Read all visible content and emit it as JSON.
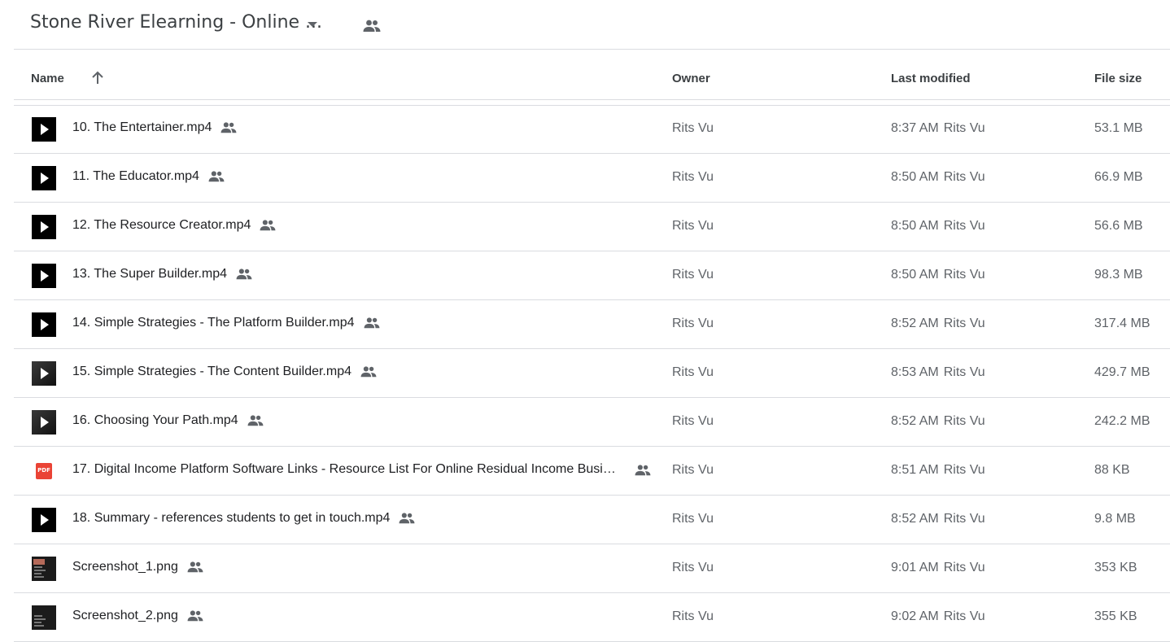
{
  "header": {
    "folder_title": "Stone River Elearning - Online ...",
    "title_dropdown_icon": "caret-down-icon",
    "title_shared_icon": "people-icon"
  },
  "columns": {
    "name": "Name",
    "owner": "Owner",
    "last_modified": "Last modified",
    "file_size": "File size",
    "sort_icon": "arrow-up-icon"
  },
  "colors": {
    "text": "#3c4043",
    "muted": "#5f6368",
    "divider": "#dadce0",
    "pdf": "#ea4335"
  },
  "files": [
    {
      "type": "video",
      "name": "10. The Entertainer.mp4",
      "owner": "Rits Vu",
      "time": "8:37 AM",
      "modified_by": "Rits Vu",
      "size": "53.1 MB",
      "shared": true
    },
    {
      "type": "video",
      "name": "11. The Educator.mp4",
      "owner": "Rits Vu",
      "time": "8:50 AM",
      "modified_by": "Rits Vu",
      "size": "66.9 MB",
      "shared": true
    },
    {
      "type": "video",
      "name": "12. The Resource Creator.mp4",
      "owner": "Rits Vu",
      "time": "8:50 AM",
      "modified_by": "Rits Vu",
      "size": "56.6 MB",
      "shared": true
    },
    {
      "type": "video",
      "name": "13. The Super Builder.mp4",
      "owner": "Rits Vu",
      "time": "8:50 AM",
      "modified_by": "Rits Vu",
      "size": "98.3 MB",
      "shared": true
    },
    {
      "type": "video",
      "name": "14. Simple Strategies - The Platform Builder.mp4",
      "owner": "Rits Vu",
      "time": "8:52 AM",
      "modified_by": "Rits Vu",
      "size": "317.4 MB",
      "shared": true
    },
    {
      "type": "video-dark",
      "name": "15. Simple Strategies - The Content Builder.mp4",
      "owner": "Rits Vu",
      "time": "8:53 AM",
      "modified_by": "Rits Vu",
      "size": "429.7 MB",
      "shared": true
    },
    {
      "type": "video-dark",
      "name": "16. Choosing Your Path.mp4",
      "owner": "Rits Vu",
      "time": "8:52 AM",
      "modified_by": "Rits Vu",
      "size": "242.2 MB",
      "shared": true
    },
    {
      "type": "pdf",
      "pdf_label": "PDF",
      "name": "17. Digital Income Platform Software Links - Resource List For Online Residual Income Busi…",
      "owner": "Rits Vu",
      "time": "8:51 AM",
      "modified_by": "Rits Vu",
      "size": "88 KB",
      "shared": true
    },
    {
      "type": "video",
      "name": "18. Summary - references students to get in touch.mp4",
      "owner": "Rits Vu",
      "time": "8:52 AM",
      "modified_by": "Rits Vu",
      "size": "9.8 MB",
      "shared": true
    },
    {
      "type": "image",
      "name": "Screenshot_1.png",
      "owner": "Rits Vu",
      "time": "9:01 AM",
      "modified_by": "Rits Vu",
      "size": "353 KB",
      "shared": true
    },
    {
      "type": "image-dark",
      "name": "Screenshot_2.png",
      "owner": "Rits Vu",
      "time": "9:02 AM",
      "modified_by": "Rits Vu",
      "size": "355 KB",
      "shared": true
    }
  ]
}
